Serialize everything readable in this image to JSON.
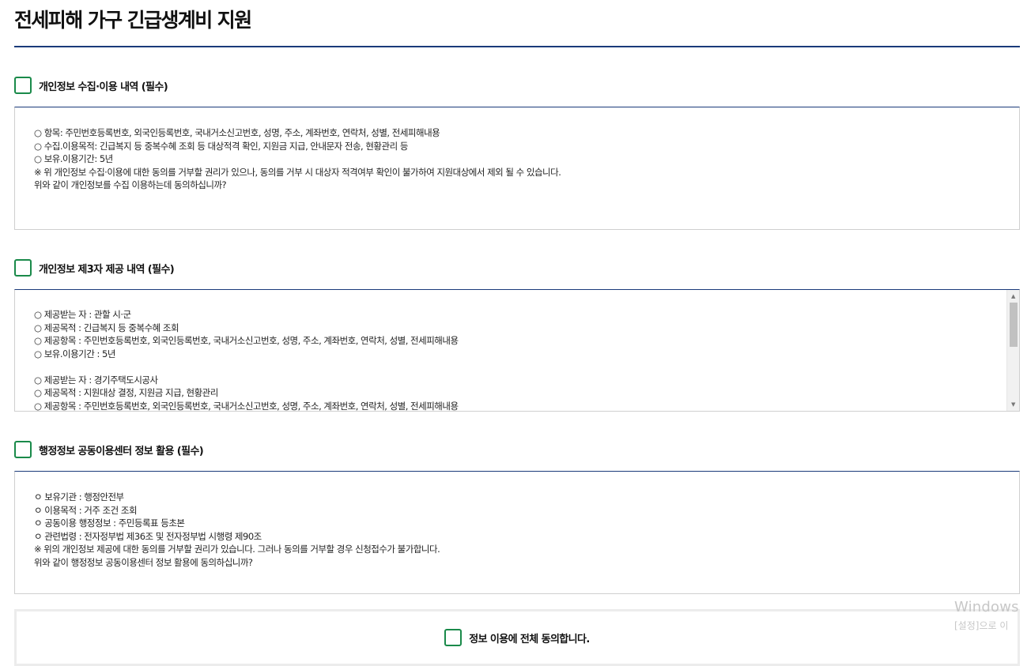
{
  "page": {
    "title": "전세피해 가구 긴급생계비 지원"
  },
  "sections": [
    {
      "label": "개인정보 수집·이용 내역 (필수)",
      "lines": [
        "○ 항목: 주민번호등록번호, 외국인등록번호, 국내거소신고번호, 성명, 주소, 계좌번호, 연락처, 성별, 전세피해내용",
        "○ 수집.이용목적: 긴급복지 등 중복수혜 조회 등 대상적격 확인, 지원금 지급, 안내문자 전송, 현황관리 등",
        "○ 보유.이용기간: 5년",
        "※ 위 개인정보 수집·이용에 대한 동의를 거부할 권리가 있으나, 동의를 거부 시 대상자 적격여부 확인이 불가하여 지원대상에서 제외 될 수 있습니다.",
        "위와 같이 개인정보를 수집 이용하는데 동의하십니까?"
      ]
    },
    {
      "label": "개인정보 제3자 제공 내역 (필수)",
      "lines": [
        "○ 제공받는 자 : 관할 시·군",
        "○ 제공목적 : 긴급복지 등 중복수혜 조회",
        "○ 제공항목 : 주민번호등록번호, 외국인등록번호, 국내거소신고번호, 성명, 주소, 계좌번호, 연락처, 성별, 전세피해내용",
        "○ 보유.이용기간 : 5년",
        "",
        "○ 제공받는 자 : 경기주택도시공사",
        "○ 제공목적 : 지원대상 결정, 지원금 지급, 현황관리",
        "○ 제공항목 : 주민번호등록번호, 외국인등록번호, 국내거소신고번호, 성명, 주소, 계좌번호, 연락처, 성별, 전세피해내용"
      ]
    },
    {
      "label": "행정정보 공동이용센터 정보 활용 (필수)",
      "lines": [
        "ㅇ 보유기관 : 행정안전부",
        "ㅇ 이용목적 : 거주 조건 조회",
        "ㅇ 공동이용 행정정보 : 주민등록표 등초본",
        "ㅇ 관련법령 : 전자정부법 제36조 및 전자정부법 시행령 제90조",
        "※ 위의 개인정보 제공에 대한 동의를 거부할 권리가 있습니다. 그러나 동의를 거부할 경우 신청접수가 불가합니다.",
        "위와 같이 행정정보 공동이용센터 정보 활용에 동의하십니까?"
      ]
    }
  ],
  "all_agree": {
    "label": "정보 이용에 전체 동의합니다."
  },
  "watermark": {
    "title": "Windows",
    "subtitle": "[설정]으로 이"
  }
}
